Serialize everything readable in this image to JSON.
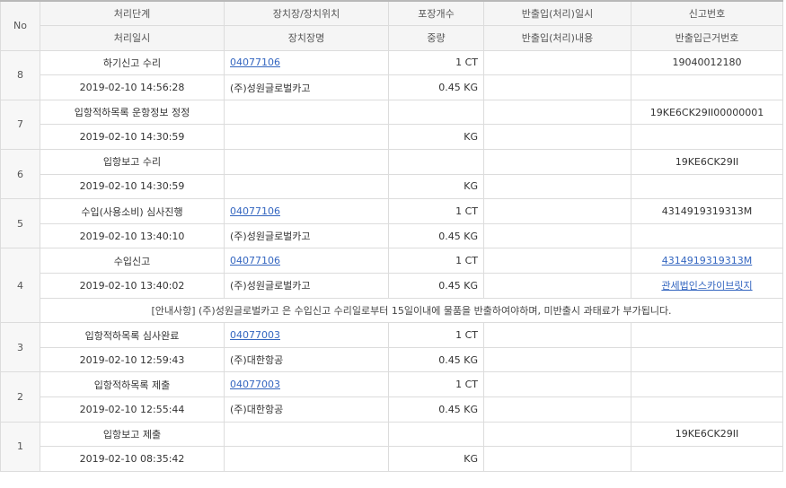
{
  "header": {
    "no": "No",
    "row1": [
      "처리단계",
      "장치장/장치위치",
      "포장개수",
      "반출입(처리)일시",
      "신고번호"
    ],
    "row2": [
      "처리일시",
      "장치장명",
      "중량",
      "반출입(처리)내용",
      "반출입근거번호"
    ]
  },
  "rows": [
    {
      "no": "8",
      "step": "하기신고 수리",
      "warehouse_code": "04077106",
      "packages": "1 CT",
      "inout_datetime": "",
      "report_no": "19040012180",
      "datetime": "2019-02-10 14:56:28",
      "warehouse_name": "(주)성원글로벌카고",
      "weight": "0.45 KG",
      "inout_content": "",
      "basis_no": ""
    },
    {
      "no": "7",
      "step": "입항적하목록 운항정보 정정",
      "warehouse_code": "",
      "packages": "",
      "inout_datetime": "",
      "report_no": "19KE6CK29II00000001",
      "datetime": "2019-02-10 14:30:59",
      "warehouse_name": "",
      "weight": "KG",
      "inout_content": "",
      "basis_no": ""
    },
    {
      "no": "6",
      "step": "입항보고 수리",
      "warehouse_code": "",
      "packages": "",
      "inout_datetime": "",
      "report_no": "19KE6CK29II",
      "datetime": "2019-02-10 14:30:59",
      "warehouse_name": "",
      "weight": "KG",
      "inout_content": "",
      "basis_no": ""
    },
    {
      "no": "5",
      "step": "수입(사용소비) 심사진행",
      "warehouse_code": "04077106",
      "packages": "1 CT",
      "inout_datetime": "",
      "report_no": "4314919319313M",
      "datetime": "2019-02-10 13:40:10",
      "warehouse_name": "(주)성원글로벌카고",
      "weight": "0.45 KG",
      "inout_content": "",
      "basis_no": ""
    },
    {
      "no": "4",
      "step": "수입신고",
      "warehouse_code": "04077106",
      "packages": "1 CT",
      "inout_datetime": "",
      "report_no": "4314919319313M",
      "datetime": "2019-02-10 13:40:02",
      "warehouse_name": "(주)성원글로벌카고",
      "weight": "0.45 KG",
      "inout_content": "",
      "basis_no": "관세법인스카이브릿지"
    },
    {
      "no": "3",
      "step": "입항적하목록 심사완료",
      "warehouse_code": "04077003",
      "packages": "1 CT",
      "inout_datetime": "",
      "report_no": "",
      "datetime": "2019-02-10 12:59:43",
      "warehouse_name": "(주)대한항공",
      "weight": "0.45 KG",
      "inout_content": "",
      "basis_no": ""
    },
    {
      "no": "2",
      "step": "입항적하목록 제출",
      "warehouse_code": "04077003",
      "packages": "1 CT",
      "inout_datetime": "",
      "report_no": "",
      "datetime": "2019-02-10 12:55:44",
      "warehouse_name": "(주)대한항공",
      "weight": "0.45 KG",
      "inout_content": "",
      "basis_no": ""
    },
    {
      "no": "1",
      "step": "입항보고 제출",
      "warehouse_code": "",
      "packages": "",
      "inout_datetime": "",
      "report_no": "19KE6CK29II",
      "datetime": "2019-02-10 08:35:42",
      "warehouse_name": "",
      "weight": "KG",
      "inout_content": "",
      "basis_no": ""
    }
  ],
  "notice": "[안내사항] (주)성원글로벌카고 은 수입신고 수리일로부터 15일이내에 물품을 반출하여야하며, 미반출시 과태료가 부가됩니다."
}
